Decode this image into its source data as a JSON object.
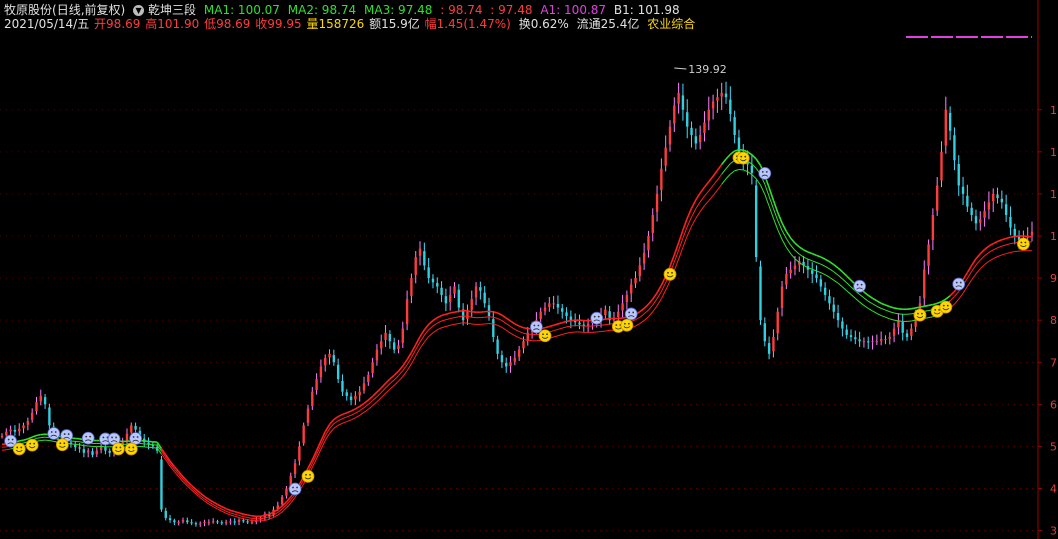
{
  "header": {
    "stock_name": "牧原股份",
    "period_mode": "(日线,前复权)",
    "indicator_name": "乾坤三段",
    "ma1": "MA1: 100.07",
    "ma2": "MA2: 98.74",
    "ma3": "MA3: 97.48",
    "v1": ": 98.74",
    "v2": ": 97.48",
    "a1": "A1: 100.87",
    "b1": "B1: 101.98",
    "date": "2021/05/14/五",
    "open": "开98.69",
    "high": "高101.90",
    "low": "低98.69",
    "close": "收99.95",
    "volume": "量158726",
    "amount": "额15.9亿",
    "change": "幅1.45(1.47%)",
    "turnover": "换0.62%",
    "float_cap": "流通25.4亿",
    "sector": "农业综合"
  },
  "colors": {
    "background": "#000000",
    "up": "#ff3c3c",
    "down": "#30d0e0",
    "ma_green": "#30e030",
    "ma_red": "#ff2020",
    "magenta": "#e040e0",
    "gold": "#ffd700",
    "axis": "#a00000"
  },
  "chart_data": {
    "type": "line",
    "series": [
      {
        "values": [
          52.5,
          53.5,
          54,
          53.5,
          54.2,
          55,
          56,
          58,
          60.5,
          62,
          60,
          55,
          53,
          52.5,
          52,
          51,
          50.5,
          49.8,
          49.5,
          48.5,
          49,
          48,
          49,
          50,
          49,
          48.5,
          49.5,
          50,
          51,
          53,
          55,
          54,
          52,
          51,
          50.5,
          50,
          49,
          35,
          33,
          32.5,
          32,
          32,
          32.5,
          32,
          31.8,
          31.5,
          31.7,
          32,
          32,
          32.2,
          32,
          31.8,
          32,
          32.2,
          32,
          32.5,
          32.2,
          32,
          32,
          32.5,
          33,
          34,
          33.5,
          35,
          36,
          38,
          40,
          43,
          46,
          50,
          55,
          59,
          63,
          66,
          69,
          71,
          72,
          70,
          66,
          63,
          62,
          61,
          62,
          63,
          65,
          67,
          70,
          73,
          75,
          77,
          75,
          73,
          74,
          78,
          85,
          90,
          95,
          97,
          93,
          90,
          89,
          88,
          86,
          84,
          86,
          88,
          83,
          80,
          82,
          85,
          88,
          87,
          84,
          81,
          76,
          72,
          70,
          69,
          70,
          71,
          73,
          75,
          77,
          78,
          80,
          82,
          83,
          84,
          84,
          83,
          82,
          81,
          80,
          79.5,
          79,
          78.5,
          79.2,
          80,
          80,
          81,
          82.5,
          80,
          80.5,
          82,
          84,
          86,
          88.5,
          90,
          93,
          96,
          100,
          105,
          110,
          116,
          121,
          126,
          131,
          134,
          130,
          126,
          124,
          122,
          124,
          127,
          130,
          132,
          133,
          134,
          133,
          129,
          124,
          120,
          118,
          117,
          115,
          95,
          80,
          75,
          72,
          76,
          82,
          88,
          91,
          92,
          93,
          94,
          93,
          92,
          91,
          90,
          88,
          86,
          84,
          82,
          80,
          78,
          76.5,
          76,
          75.5,
          75,
          75,
          74.8,
          75,
          75,
          75.5,
          75.5,
          76,
          78,
          80,
          77,
          76,
          78,
          81,
          84,
          92,
          98,
          105,
          112,
          120,
          130,
          125,
          118,
          112,
          110,
          107,
          105,
          103,
          104,
          106,
          108,
          110,
          109,
          108,
          105,
          102,
          100,
          99,
          99.5,
          100,
          101
        ],
        "color": "#ff40ff"
      },
      {
        "values": [
          50.5,
          50.6,
          50.8,
          51,
          51.3,
          51.5,
          51.8,
          52.2,
          52.6,
          52.8,
          52.9,
          52.8,
          52.6,
          52.4,
          52.3,
          52.1,
          52,
          51.9,
          51.8,
          51.6,
          51.5,
          51.4,
          51.4,
          51.4,
          51.3,
          51.3,
          51.3,
          51.3,
          51.2,
          51.2,
          51.3,
          51.4,
          51.4,
          51.3,
          51.2,
          51.1,
          51,
          49.5,
          48,
          46.5,
          45.2,
          44,
          42.8,
          41.7,
          40.7,
          39.8,
          38.9,
          38.1,
          37.4,
          36.8,
          36.2,
          35.7,
          35.2,
          34.8,
          34.5,
          34.2,
          33.9,
          33.7,
          33.5,
          33.4,
          33.4,
          33.6,
          33.9,
          34.4,
          35,
          35.8,
          36.8,
          38,
          39.4,
          41,
          42.8,
          44.8,
          46.8,
          49,
          51.3,
          53.5,
          55.2,
          56.4,
          57.1,
          57.6,
          58,
          58.4,
          58.9,
          59.5,
          60.2,
          61,
          61.9,
          62.9,
          63.9,
          65,
          66,
          66.9,
          67.9,
          69.1,
          70.6,
          72.3,
          74.2,
          76.1,
          77.7,
          79,
          79.9,
          80.6,
          81.1,
          81.4,
          81.7,
          81.9,
          82.1,
          82.3,
          82.2,
          82,
          81.9,
          81.9,
          82,
          82.1,
          82,
          81.7,
          81.2,
          80.5,
          79.8,
          79.1,
          78.6,
          78.2,
          78,
          77.9,
          77.9,
          78,
          78.2,
          78.5,
          78.8,
          79.1,
          79.4,
          79.7,
          79.9,
          80,
          80,
          79.9,
          79.9,
          79.9,
          80,
          80.1,
          80.2,
          80.4,
          80.4,
          80.4,
          80.5,
          80.7,
          81,
          81.4,
          82,
          82.8,
          83.8,
          85,
          86.5,
          88.3,
          90.4,
          92.8,
          95.5,
          98.4,
          101.4,
          104.2,
          106.6,
          108.6,
          110.2,
          111.6,
          112.9,
          114.2,
          115.6,
          117,
          118.3,
          119.4,
          120.2,
          120.5,
          120.4,
          120,
          119.3,
          118.3,
          116.8,
          114.4,
          111.5,
          108.5,
          105.6,
          103.1,
          101.1,
          99.5,
          98.3,
          97.4,
          96.7,
          96.2,
          95.8,
          95.4,
          95,
          94.5,
          93.9,
          93.2,
          92.4,
          91.5,
          90.5,
          89.5,
          88.5,
          87.6,
          86.7,
          85.9,
          85.2,
          84.6,
          84,
          83.6,
          83.2,
          82.9,
          82.7,
          82.6,
          82.6,
          82.7,
          82.9,
          83.1,
          83.3,
          83.5,
          83.7,
          84,
          84.4,
          85,
          85.8,
          86.8,
          88.1,
          89.6,
          91.3,
          93,
          94.6,
          95.8,
          96.8,
          97.6,
          98.2,
          98.7,
          99.1,
          99.4,
          99.7,
          99.9,
          100,
          100,
          99.9,
          99.8,
          99.8,
          99.8,
          99.9,
          100,
          100.07
        ],
        "color": "#30e030"
      },
      {
        "values": [
          49.8,
          49.9,
          50.1,
          50.3,
          50.6,
          50.8,
          51.1,
          51.5,
          51.9,
          52.1,
          52.2,
          52.1,
          51.9,
          51.7,
          51.6,
          51.4,
          51.3,
          51.2,
          51.1,
          50.9,
          50.8,
          50.7,
          50.7,
          50.7,
          50.6,
          50.6,
          50.6,
          50.6,
          50.5,
          50.5,
          50.6,
          50.7,
          50.7,
          50.6,
          50.5,
          50.4,
          50.3,
          48.9,
          47.4,
          45.9,
          44.6,
          43.4,
          42.2,
          41.1,
          40.1,
          39.2,
          38.3,
          37.5,
          36.8,
          36.2,
          35.6,
          35.1,
          34.6,
          34.2,
          33.9,
          33.6,
          33.3,
          33.1,
          32.9,
          32.8,
          32.8,
          33,
          33.3,
          33.7,
          34.3,
          35.1,
          36.1,
          37.3,
          38.6,
          40.2,
          42,
          43.9,
          45.9,
          48.1,
          50.3,
          52.5,
          54.2,
          55.4,
          56.1,
          56.6,
          57,
          57.4,
          57.9,
          58.5,
          59.2,
          60,
          60.9,
          61.8,
          62.8,
          63.9,
          64.9,
          65.8,
          66.8,
          68,
          69.4,
          71.1,
          73,
          74.8,
          76.4,
          77.7,
          78.6,
          79.3,
          79.8,
          80.1,
          80.4,
          80.6,
          80.8,
          81,
          80.9,
          80.7,
          80.6,
          80.6,
          80.7,
          80.8,
          80.7,
          80.4,
          79.9,
          79.2,
          78.5,
          77.8,
          77.3,
          76.9,
          76.7,
          76.6,
          76.6,
          76.7,
          76.9,
          77.2,
          77.5,
          77.8,
          78.1,
          78.4,
          78.6,
          78.7,
          78.7,
          78.6,
          78.6,
          78.6,
          78.7,
          78.8,
          78.9,
          79.1,
          79.1,
          79.1,
          79.2,
          79.4,
          79.7,
          80.1,
          80.7,
          81.5,
          82.4,
          83.6,
          85.1,
          86.8,
          88.9,
          91.2,
          93.8,
          96.6,
          99.5,
          102.2,
          104.5,
          106.5,
          108.1,
          109.5,
          110.7,
          112,
          113.3,
          114.7,
          116,
          117.2,
          118,
          118.3,
          118.2,
          117.8,
          117.1,
          116.1,
          114.6,
          112.3,
          109.4,
          106.5,
          103.7,
          101.3,
          99.4,
          97.8,
          96.6,
          95.7,
          95,
          94.5,
          94.1,
          93.7,
          93.3,
          92.8,
          92.2,
          91.5,
          90.7,
          89.8,
          88.9,
          87.9,
          87,
          86.1,
          85.3,
          84.5,
          83.9,
          83.3,
          82.8,
          82.4,
          82,
          81.7,
          81.5,
          81.4,
          81.4,
          81.5,
          81.7,
          81.9,
          82.1,
          82.3,
          82.5,
          82.8,
          83.2,
          83.8,
          84.6,
          85.6,
          86.8,
          88.3,
          89.9,
          91.6,
          93.1,
          94.3,
          95.3,
          96.1,
          96.7,
          97.2,
          97.6,
          97.9,
          98.2,
          98.4,
          98.5,
          98.6,
          98.6,
          98.6,
          98.6,
          98.6,
          98.7,
          98.74
        ],
        "color": "#30e030"
      },
      {
        "values": [
          49.1,
          49.2,
          49.4,
          49.6,
          49.9,
          50.1,
          50.4,
          50.8,
          51.2,
          51.4,
          51.5,
          51.4,
          51.2,
          51,
          50.9,
          50.7,
          50.6,
          50.5,
          50.4,
          50.2,
          50.1,
          50,
          50,
          50,
          49.9,
          49.9,
          49.9,
          49.9,
          49.8,
          49.8,
          49.9,
          50,
          50,
          49.9,
          49.8,
          49.7,
          49.6,
          48.2,
          46.8,
          45.3,
          44,
          42.8,
          41.6,
          40.6,
          39.6,
          38.7,
          37.8,
          37,
          36.3,
          35.7,
          35.1,
          34.6,
          34.1,
          33.7,
          33.4,
          33.1,
          32.8,
          32.6,
          32.4,
          32.3,
          32.3,
          32.4,
          32.7,
          33.1,
          33.7,
          34.4,
          35.4,
          36.5,
          37.9,
          39.4,
          41.1,
          43,
          45,
          47.1,
          49.3,
          51.4,
          53.1,
          54.3,
          55,
          55.5,
          55.9,
          56.3,
          56.8,
          57.4,
          58.1,
          58.8,
          59.7,
          60.6,
          61.6,
          62.6,
          63.6,
          64.5,
          65.5,
          66.6,
          68,
          69.6,
          71.5,
          73.3,
          74.8,
          76.1,
          77,
          77.7,
          78.2,
          78.5,
          78.8,
          79,
          79.2,
          79.4,
          79.3,
          79.1,
          79,
          79,
          79.1,
          79.2,
          79.1,
          78.8,
          78.3,
          77.6,
          76.9,
          76.3,
          75.8,
          75.4,
          75.2,
          75.1,
          75.1,
          75.2,
          75.4,
          75.7,
          76,
          76.3,
          76.6,
          76.9,
          77.1,
          77.2,
          77.2,
          77.1,
          77.1,
          77.1,
          77.2,
          77.3,
          77.4,
          77.6,
          77.6,
          77.6,
          77.7,
          77.9,
          78.2,
          78.6,
          79.2,
          79.9,
          80.8,
          82,
          83.4,
          85.1,
          87.1,
          89.3,
          91.8,
          94.5,
          97.3,
          100,
          102.3,
          104.2,
          105.8,
          107.2,
          108.4,
          109.6,
          110.9,
          112.3,
          113.6,
          114.7,
          115.5,
          115.8,
          115.7,
          115.3,
          114.6,
          113.6,
          112.1,
          109.9,
          107.1,
          104.2,
          101.5,
          99.2,
          97.3,
          95.8,
          94.6,
          93.7,
          93,
          92.5,
          92.1,
          91.7,
          91.3,
          90.8,
          90.2,
          89.5,
          88.8,
          87.9,
          87,
          86.1,
          85.2,
          84.3,
          83.5,
          82.8,
          82.2,
          81.6,
          81.1,
          80.7,
          80.3,
          80,
          79.8,
          79.7,
          79.7,
          79.8,
          80,
          80.2,
          80.4,
          80.6,
          80.8,
          81.1,
          81.5,
          82.1,
          82.9,
          83.8,
          85,
          86.4,
          88,
          89.6,
          91,
          92.2,
          93.2,
          94,
          94.6,
          95.1,
          95.5,
          95.8,
          96.1,
          96.3,
          96.4,
          96.5,
          96.5,
          96.5,
          96.5,
          96.5,
          96.6,
          97.48
        ],
        "color": "#30e030"
      }
    ],
    "ylim": [
      28,
      148
    ],
    "y_ticks": [
      3,
      4,
      5,
      6,
      7,
      8,
      9,
      1,
      1,
      1,
      1
    ],
    "max_annotation": "139.92",
    "max_value": 139.92,
    "max_index": 156,
    "ma_green_segments": [
      [
        3,
        37
      ],
      [
        168,
        220
      ]
    ],
    "buy_markers": [
      4,
      7,
      14,
      27,
      30,
      71,
      126,
      143,
      145,
      155,
      171,
      172,
      213,
      217,
      219,
      237
    ],
    "sell_markers": [
      2,
      12,
      15,
      20,
      24,
      26,
      31,
      68,
      124,
      138,
      146,
      177,
      199,
      222
    ]
  }
}
